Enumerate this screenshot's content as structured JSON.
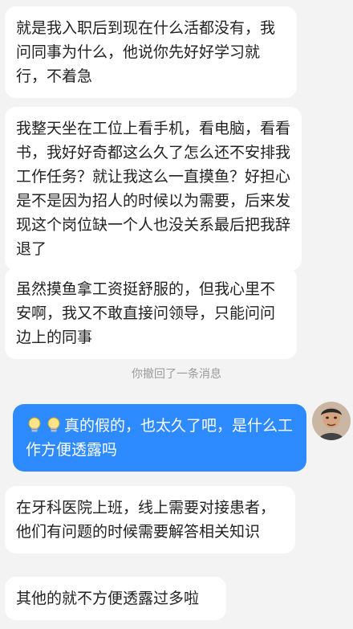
{
  "messages": [
    {
      "text": "就是我入职后到现在什么活都没有，我问同事为什么，他说你先好好学习就行，不着急"
    },
    {
      "text": "我整天坐在工位上看手机，看电脑，看看书，我好好奇都这么久了怎么还不安排我工作任务？就让我这么一直摸鱼？好担心是不是因为招人的时候以为需要，后来发现这个岗位缺一个人也没关系最后把我辞退了"
    },
    {
      "text": "虽然摸鱼拿工资挺舒服的，但我心里不安啊，我又不敢直接问领导，只能问问边上的同事"
    },
    {
      "text": "真的假的，也太久了吧，是什么工作方便透露吗"
    },
    {
      "text": "在牙科医院上班，线上需要对接患者，他们有问题的时候需要解答相关知识"
    },
    {
      "text": "其他的就不方便透露过多啦"
    }
  ],
  "system_note": "你撤回了一条消息",
  "icons": {
    "emoji": "lightbulb-emoji-icon",
    "avatar": "user-avatar"
  },
  "colors": {
    "background": "#f3f3f3",
    "incoming_bubble": "#ffffff",
    "outgoing_bubble": "#2d8bff",
    "system_text": "#9a9a9a"
  }
}
